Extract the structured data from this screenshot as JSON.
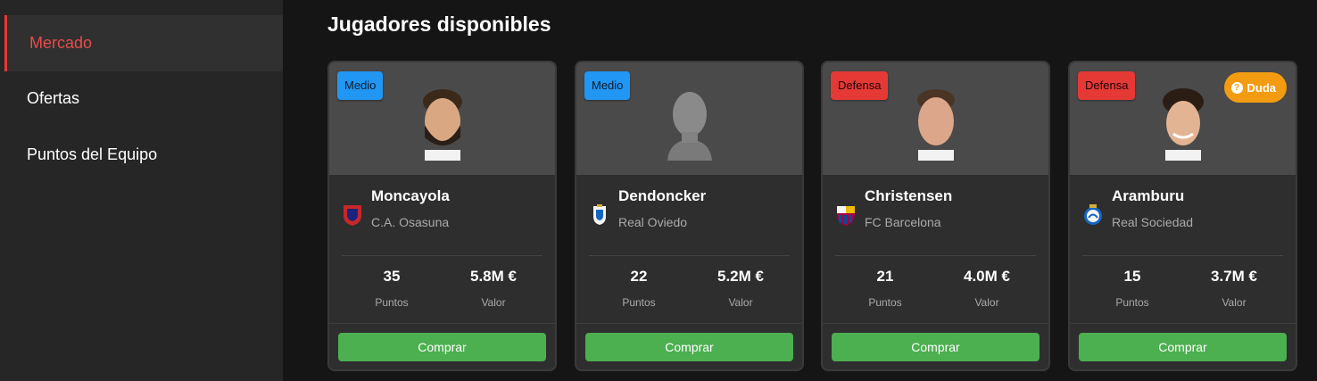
{
  "sidebar": {
    "items": [
      {
        "label": "Mercado",
        "active": true
      },
      {
        "label": "Ofertas",
        "active": false
      },
      {
        "label": "Puntos del Equipo",
        "active": false
      }
    ]
  },
  "main": {
    "title": "Jugadores disponibles",
    "cards": [
      {
        "position": "Medio",
        "name": "Moncayola",
        "club": "C.A. Osasuna",
        "points": "35",
        "points_label": "Puntos",
        "value": "5.8M €",
        "value_label": "Valor",
        "buy_label": "Comprar",
        "status": null
      },
      {
        "position": "Medio",
        "name": "Dendoncker",
        "club": "Real Oviedo",
        "points": "22",
        "points_label": "Puntos",
        "value": "5.2M €",
        "value_label": "Valor",
        "buy_label": "Comprar",
        "status": null
      },
      {
        "position": "Defensa",
        "name": "Christensen",
        "club": "FC Barcelona",
        "points": "21",
        "points_label": "Puntos",
        "value": "4.0M €",
        "value_label": "Valor",
        "buy_label": "Comprar",
        "status": null
      },
      {
        "position": "Defensa",
        "name": "Aramburu",
        "club": "Real Sociedad",
        "points": "15",
        "points_label": "Puntos",
        "value": "3.7M €",
        "value_label": "Valor",
        "buy_label": "Comprar",
        "status": "Duda",
        "status_icon": "?"
      }
    ]
  },
  "colors": {
    "background": "#151515",
    "sidebar": "#262626",
    "active": "#e53935",
    "medio": "#2196f3",
    "defensa": "#e53935",
    "buy": "#4caf50",
    "status_duda": "#f39c12"
  }
}
